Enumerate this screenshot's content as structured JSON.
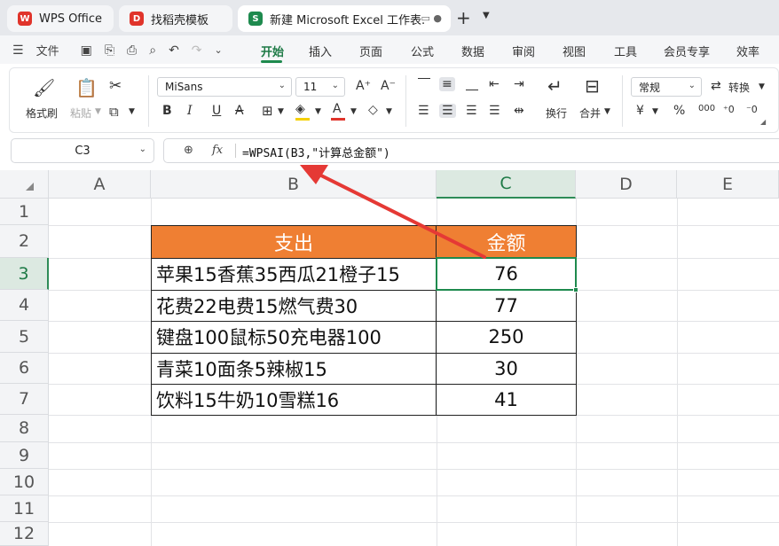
{
  "tabs": [
    {
      "label": "WPS Office",
      "logo_color": "#e0342b",
      "logo_glyph": "W"
    },
    {
      "label": "找稻壳模板",
      "logo_color": "#e0342b",
      "logo_glyph": "D"
    },
    {
      "label": "新建 Microsoft Excel 工作表.",
      "logo_color": "#1e8a4e",
      "logo_glyph": "S"
    }
  ],
  "menu": {
    "file_label": "文件",
    "tabs": [
      "开始",
      "插入",
      "页面",
      "公式",
      "数据",
      "审阅",
      "视图",
      "工具",
      "会员专享",
      "效率"
    ],
    "active_tab": "开始"
  },
  "ribbon": {
    "format_painter": "格式刷",
    "paste": "粘贴",
    "font_name": "MiSans",
    "font_size": "11",
    "wrap": "换行",
    "merge": "合并",
    "number_format": "常规",
    "convert": "转换",
    "currency_symbol": "¥",
    "percent_symbol": "%",
    "thousands_symbol": "000",
    "font_color": "#e0342b",
    "highlight_color": "#f5d000"
  },
  "formula_bar": {
    "cell_ref": "C3",
    "fx_label": "fx",
    "formula": "=WPSAI(B3,\"计算总金额\")"
  },
  "sheet": {
    "columns": [
      "A",
      "B",
      "C",
      "D",
      "E"
    ],
    "rows": [
      "1",
      "2",
      "3",
      "4",
      "5",
      "6",
      "7",
      "8",
      "9",
      "10",
      "11",
      "12"
    ],
    "selected_column": "C",
    "selected_row": "3",
    "header_fill": "#ef7f33",
    "table": {
      "headers": [
        "支出",
        "金额"
      ],
      "rows": [
        [
          "苹果15香蕉35西瓜21橙子15",
          "76"
        ],
        [
          "花费22电费15燃气费30",
          "77"
        ],
        [
          "键盘100鼠标50充电器100",
          "250"
        ],
        [
          "青菜10面条5辣椒15",
          "30"
        ],
        [
          "饮料15牛奶10雪糕16",
          "41"
        ]
      ]
    }
  },
  "annotation": {
    "arrow_color": "#e53935"
  }
}
